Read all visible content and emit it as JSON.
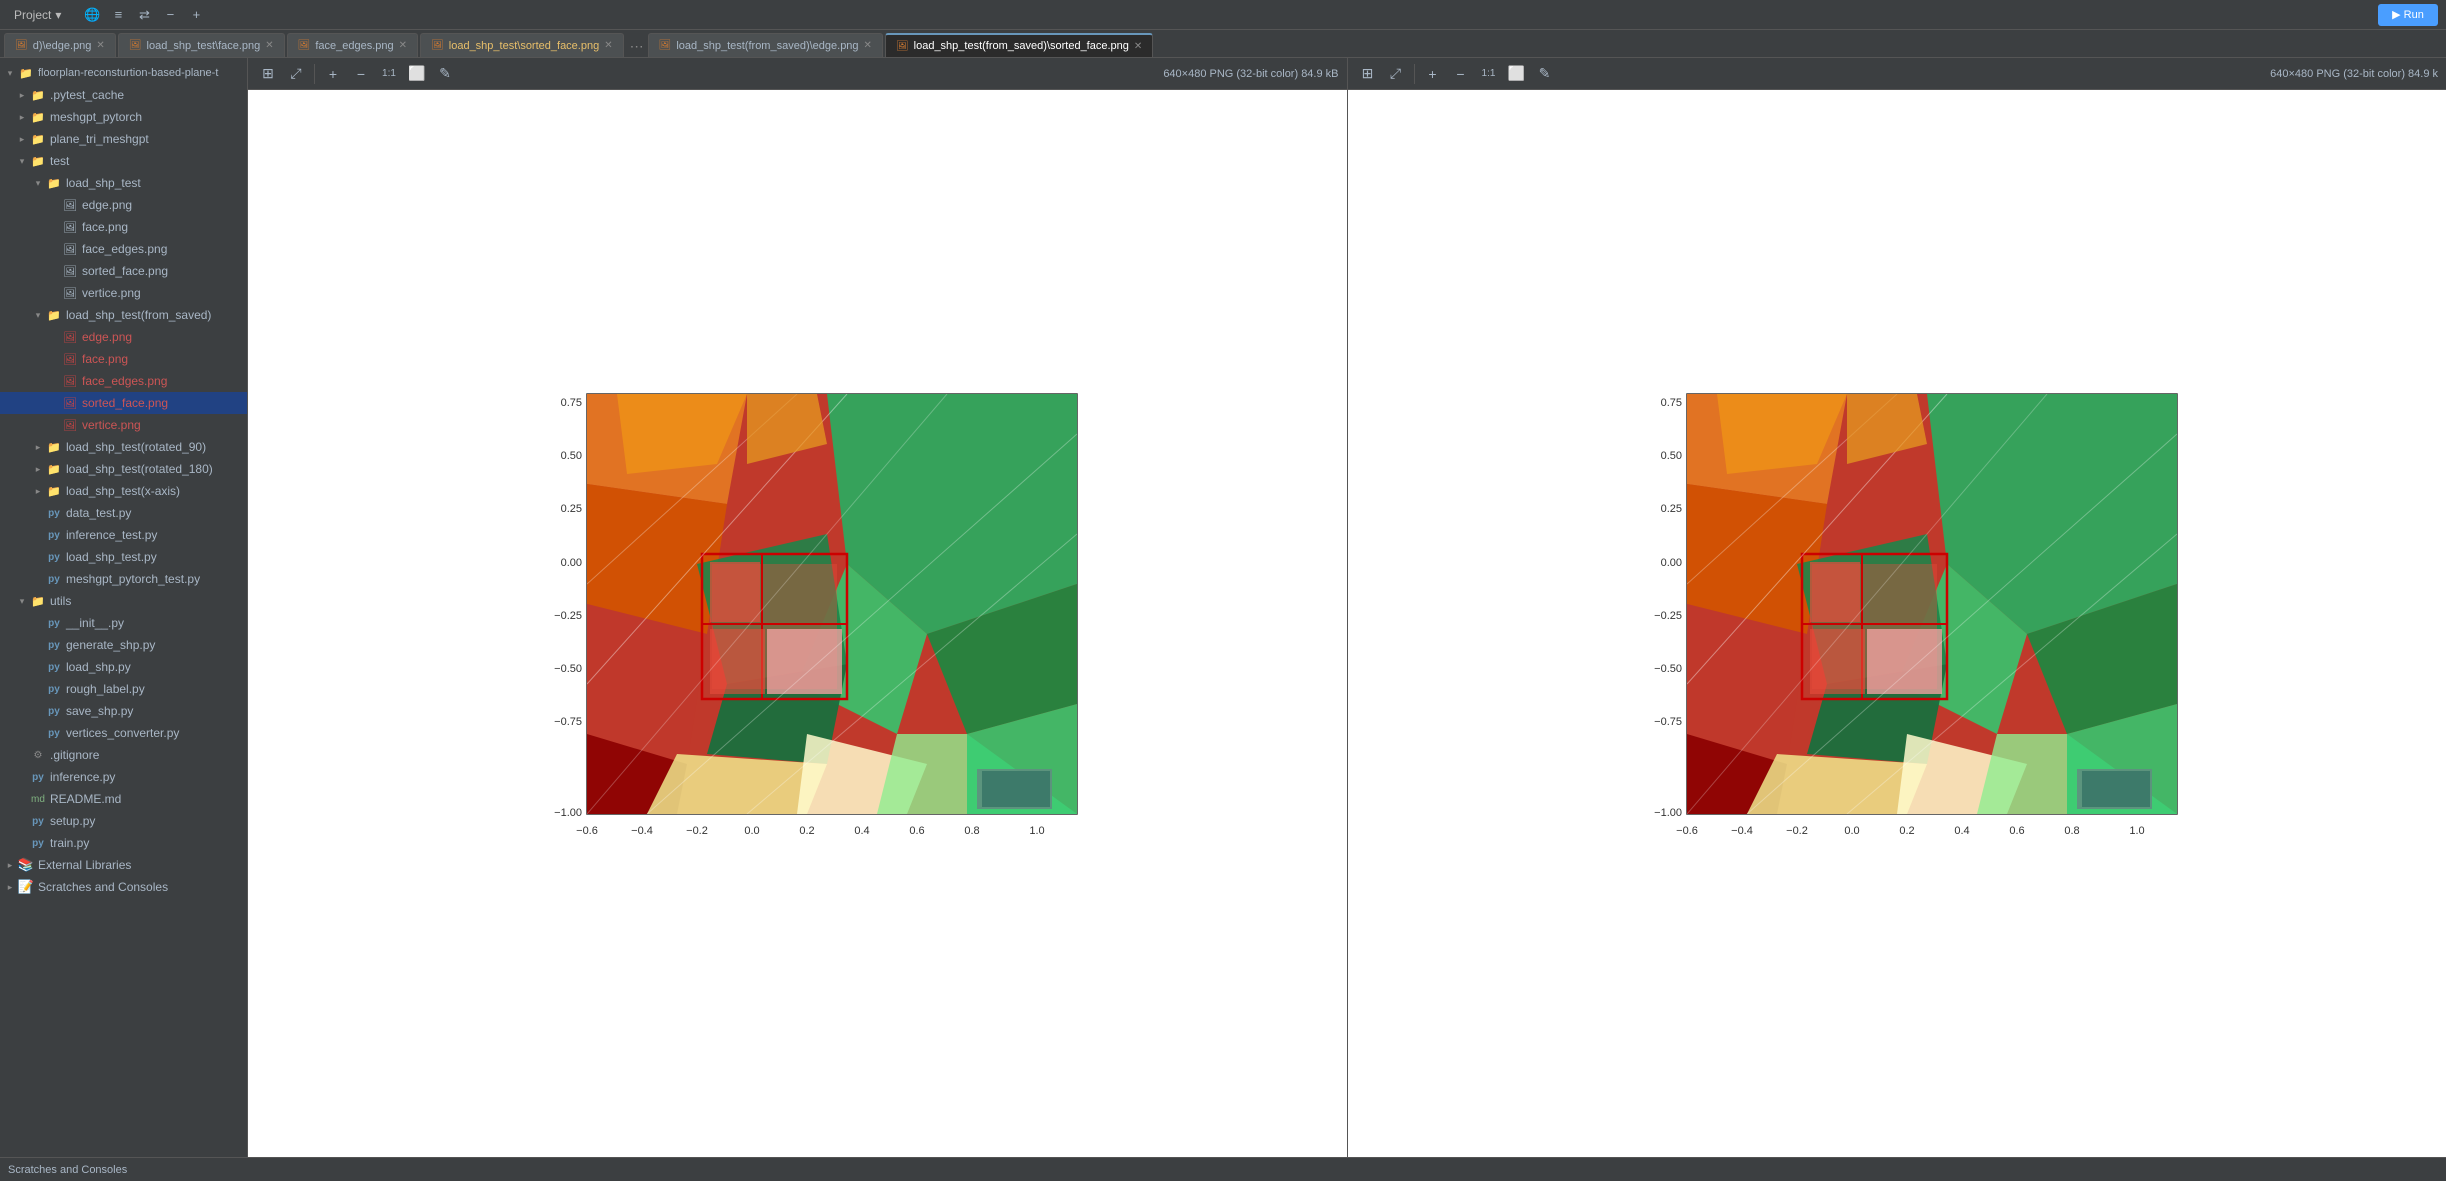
{
  "topbar": {
    "project_label": "Project",
    "chevron": "▾"
  },
  "tabs": [
    {
      "id": "tab1",
      "label": "d)\\edge.png",
      "active": false,
      "highlighted": false
    },
    {
      "id": "tab2",
      "label": "load_shp_test\\face.png",
      "active": false,
      "highlighted": false
    },
    {
      "id": "tab3",
      "label": "face_edges.png",
      "active": false,
      "highlighted": false
    },
    {
      "id": "tab4",
      "label": "load_shp_test\\sorted_face.png",
      "active": false,
      "highlighted": true
    },
    {
      "id": "tab5",
      "label": "load_shp_test(from_saved)\\edge.png",
      "active": false,
      "highlighted": false
    },
    {
      "id": "tab6",
      "label": "load_shp_test(from_saved)\\sorted_face.png",
      "active": true,
      "highlighted": false
    }
  ],
  "image_info_left": "640×480 PNG (32-bit color) 84.9 kB",
  "image_info_right": "640×480 PNG (32-bit color) 84.9 k",
  "sidebar": {
    "items": [
      {
        "level": 0,
        "type": "folder",
        "open": true,
        "label": "floorplan-reconsturtion-based-plane-t",
        "arrow": "▾"
      },
      {
        "level": 1,
        "type": "folder",
        "open": false,
        "label": ".pytest_cache",
        "arrow": "▸"
      },
      {
        "level": 1,
        "type": "folder",
        "open": false,
        "label": "meshgpt_pytorch",
        "arrow": "▸"
      },
      {
        "level": 1,
        "type": "folder",
        "open": false,
        "label": "plane_tri_meshgpt",
        "arrow": "▸"
      },
      {
        "level": 1,
        "type": "folder",
        "open": true,
        "label": "test",
        "arrow": "▾"
      },
      {
        "level": 2,
        "type": "folder",
        "open": true,
        "label": "load_shp_test",
        "arrow": "▾"
      },
      {
        "level": 3,
        "type": "png",
        "label": "edge.png",
        "color": "normal"
      },
      {
        "level": 3,
        "type": "png",
        "label": "face.png",
        "color": "normal"
      },
      {
        "level": 3,
        "type": "png",
        "label": "face_edges.png",
        "color": "normal"
      },
      {
        "level": 3,
        "type": "png",
        "label": "sorted_face.png",
        "color": "normal"
      },
      {
        "level": 3,
        "type": "png",
        "label": "vertice.png",
        "color": "normal"
      },
      {
        "level": 2,
        "type": "folder",
        "open": true,
        "label": "load_shp_test(from_saved)",
        "arrow": "▾"
      },
      {
        "level": 3,
        "type": "png",
        "label": "edge.png",
        "color": "red"
      },
      {
        "level": 3,
        "type": "png",
        "label": "face.png",
        "color": "red"
      },
      {
        "level": 3,
        "type": "png",
        "label": "face_edges.png",
        "color": "red"
      },
      {
        "level": 3,
        "type": "png",
        "label": "sorted_face.png",
        "color": "red",
        "selected": true
      },
      {
        "level": 3,
        "type": "png",
        "label": "vertice.png",
        "color": "red"
      },
      {
        "level": 2,
        "type": "folder",
        "open": false,
        "label": "load_shp_test(rotated_90)",
        "arrow": "▸"
      },
      {
        "level": 2,
        "type": "folder",
        "open": false,
        "label": "load_shp_test(rotated_180)",
        "arrow": "▸"
      },
      {
        "level": 2,
        "type": "folder",
        "open": false,
        "label": "load_shp_test(x-axis)",
        "arrow": "▸"
      },
      {
        "level": 2,
        "type": "py",
        "label": "data_test.py"
      },
      {
        "level": 2,
        "type": "py",
        "label": "inference_test.py"
      },
      {
        "level": 2,
        "type": "py",
        "label": "load_shp_test.py"
      },
      {
        "level": 2,
        "type": "py",
        "label": "meshgpt_pytorch_test.py"
      },
      {
        "level": 1,
        "type": "folder",
        "open": true,
        "label": "utils",
        "arrow": "▾"
      },
      {
        "level": 2,
        "type": "py",
        "label": "__init__.py"
      },
      {
        "level": 2,
        "type": "py",
        "label": "generate_shp.py"
      },
      {
        "level": 2,
        "type": "py",
        "label": "load_shp.py"
      },
      {
        "level": 2,
        "type": "py",
        "label": "rough_label.py"
      },
      {
        "level": 2,
        "type": "py",
        "label": "save_shp.py"
      },
      {
        "level": 2,
        "type": "py",
        "label": "vertices_converter.py"
      },
      {
        "level": 1,
        "type": "gitignore",
        "label": ".gitignore"
      },
      {
        "level": 1,
        "type": "py",
        "label": "inference.py"
      },
      {
        "level": 1,
        "type": "md",
        "label": "README.md"
      },
      {
        "level": 1,
        "type": "py",
        "label": "setup.py"
      },
      {
        "level": 1,
        "type": "py",
        "label": "train.py"
      }
    ]
  },
  "external_libraries": "External Libraries",
  "scratches": "Scratches and Consoles",
  "chart": {
    "x_labels": [
      "-0.6",
      "-0.4",
      "-0.2",
      "0.0",
      "0.2",
      "0.4",
      "0.6",
      "0.8",
      "1.0"
    ],
    "y_labels": [
      "0.75",
      "0.50",
      "0.25",
      "0.00",
      "-0.25",
      "-0.50",
      "-0.75",
      "-1.00"
    ]
  },
  "icons": {
    "grid": "⊞",
    "expand": "⤢",
    "zoom_in": "+",
    "zoom_out": "−",
    "fit": "1:1",
    "frame": "⬜",
    "edit": "✎",
    "chevron_down": "▾",
    "more": "⋯"
  }
}
